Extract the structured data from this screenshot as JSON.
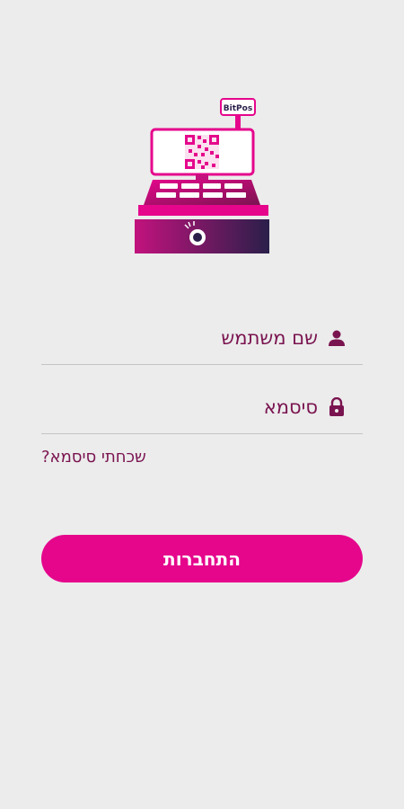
{
  "app": {
    "logo_icon": "cash-register-icon",
    "logo_badge_text": "BitPos"
  },
  "form": {
    "username_placeholder": "שם משתמש",
    "username_icon": "user-icon",
    "password_placeholder": "סיסמא",
    "password_icon": "lock-icon",
    "forgot_label": "שכחתי סיסמא?",
    "login_label": "התחברות"
  },
  "colors": {
    "primary": "#e5068c",
    "accent_dark": "#7a1450",
    "gradient_end": "#2a1f4a",
    "background": "#ececec"
  }
}
